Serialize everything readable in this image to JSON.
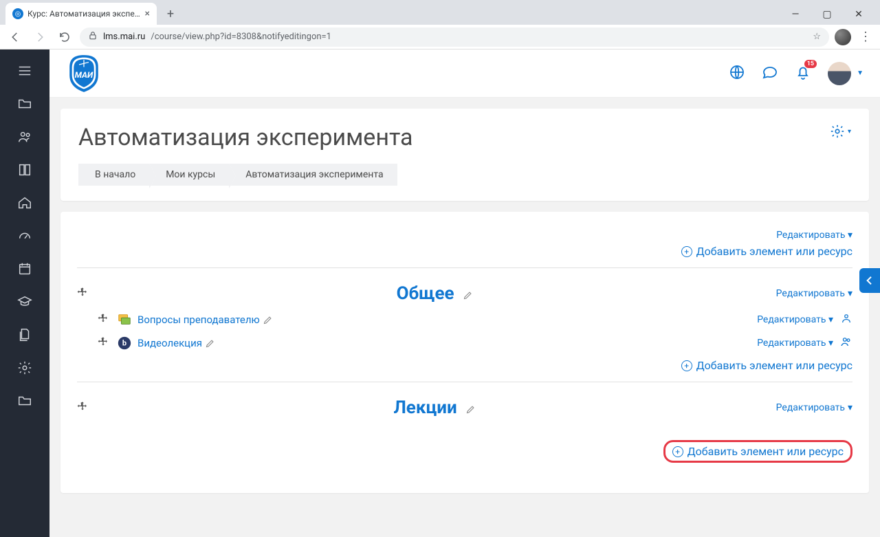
{
  "browser": {
    "tab_title": "Курс: Автоматизация экспериме",
    "url_host": "lms.mai.ru",
    "url_path": "/course/view.php?id=8308&notifyeditingon=1"
  },
  "topbar": {
    "notification_count": "15"
  },
  "course": {
    "title": "Автоматизация эксперимента"
  },
  "breadcrumb": {
    "home": "В начало",
    "mycourses": "Мои курсы",
    "current": "Автоматизация эксперимента"
  },
  "labels": {
    "edit": "Редактировать",
    "add_resource": "Добавить элемент или ресурс"
  },
  "sections": [
    {
      "title": "Общее",
      "activities": [
        {
          "name": "Вопросы преподавателю",
          "type": "forum"
        },
        {
          "name": "Видеолекция",
          "type": "bbb"
        }
      ]
    },
    {
      "title": "Лекции",
      "activities": []
    }
  ]
}
